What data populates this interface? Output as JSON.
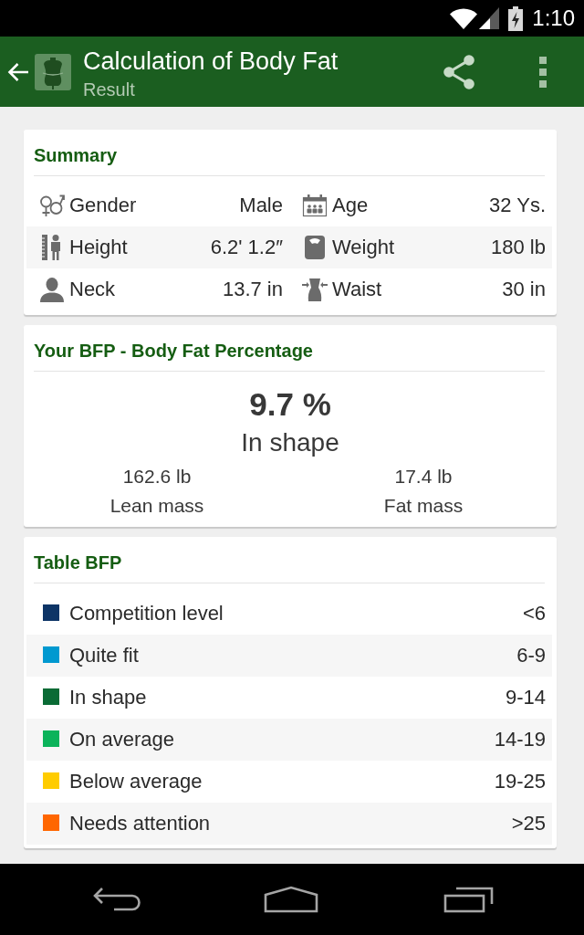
{
  "status_bar": {
    "time": "1:10"
  },
  "app_bar": {
    "title": "Calculation of Body Fat",
    "subtitle": "Result"
  },
  "summary": {
    "title": "Summary",
    "rows": [
      {
        "cells": [
          {
            "label": "Gender",
            "value": "Male"
          },
          {
            "label": "Age",
            "value": "32 Ys."
          }
        ]
      },
      {
        "cells": [
          {
            "label": "Height",
            "value": "6.2' 1.2″"
          },
          {
            "label": "Weight",
            "value": "180 lb"
          }
        ]
      },
      {
        "cells": [
          {
            "label": "Neck",
            "value": "13.7 in"
          },
          {
            "label": "Waist",
            "value": "30 in"
          }
        ]
      }
    ]
  },
  "bfp": {
    "title": "Your BFP - Body Fat Percentage",
    "percentage": "9.7 %",
    "category": "In shape",
    "masses": [
      {
        "value": "162.6 lb",
        "label": "Lean mass"
      },
      {
        "value": "17.4 lb",
        "label": "Fat mass"
      }
    ]
  },
  "table": {
    "title": "Table BFP",
    "rows": [
      {
        "label": "Competition level",
        "range": "<6",
        "color": "#0d3466"
      },
      {
        "label": "Quite fit",
        "range": "6-9",
        "color": "#0099d0"
      },
      {
        "label": "In shape",
        "range": "9-14",
        "color": "#0a6b35"
      },
      {
        "label": "On average",
        "range": "14-19",
        "color": "#0bb35a"
      },
      {
        "label": "Below average",
        "range": "19-25",
        "color": "#ffcc00"
      },
      {
        "label": "Needs attention",
        "range": ">25",
        "color": "#ff6600"
      }
    ]
  }
}
